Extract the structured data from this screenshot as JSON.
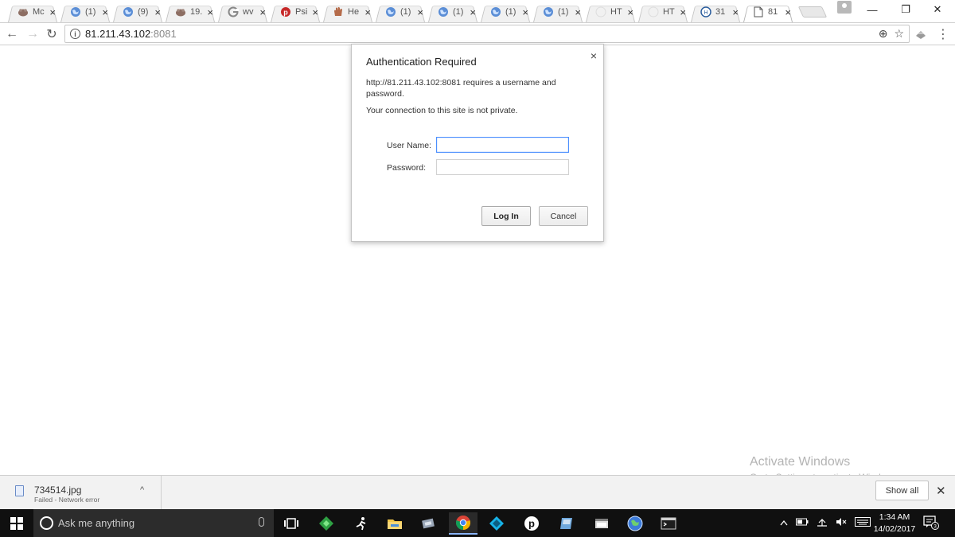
{
  "browser": {
    "tabs": [
      {
        "title": "Mc",
        "icon": "tab-icon-pet",
        "active": false
      },
      {
        "title": "(1)",
        "icon": "tab-icon-globe",
        "active": false
      },
      {
        "title": "(9)",
        "icon": "tab-icon-globe",
        "active": false
      },
      {
        "title": "19.",
        "icon": "tab-icon-pet",
        "active": false
      },
      {
        "title": "wv",
        "icon": "tab-icon-google",
        "active": false
      },
      {
        "title": "Psi",
        "icon": "tab-icon-psiphon",
        "active": false
      },
      {
        "title": "He",
        "icon": "tab-icon-hand",
        "active": false
      },
      {
        "title": "(1)",
        "icon": "tab-icon-globe",
        "active": false
      },
      {
        "title": "(1)",
        "icon": "tab-icon-globe",
        "active": false
      },
      {
        "title": "(1)",
        "icon": "tab-icon-globe",
        "active": false
      },
      {
        "title": "(1)",
        "icon": "tab-icon-globe",
        "active": false
      },
      {
        "title": "HT",
        "icon": "tab-icon-blank",
        "active": false
      },
      {
        "title": "HT",
        "icon": "tab-icon-blank",
        "active": false
      },
      {
        "title": "31",
        "icon": "tab-icon-circle",
        "active": false
      },
      {
        "title": "81",
        "icon": "tab-icon-page",
        "active": true
      }
    ],
    "close_glyph": "×",
    "window": {
      "minimize": "—",
      "restore": "❐",
      "close": "✕"
    },
    "toolbar": {
      "back": "←",
      "forward": "→",
      "reload": "↻",
      "url_host": "81.211.43.102",
      "url_port": ":8081",
      "zoom_glyph": "⊕",
      "star_glyph": "☆",
      "menu_glyph": "⋮"
    }
  },
  "dialog": {
    "title": "Authentication Required",
    "close": "×",
    "message": "http://81.211.43.102:8081 requires a username and password.",
    "privacy": "Your connection to this site is not private.",
    "username_label": "User Name:",
    "password_label": "Password:",
    "username_value": "",
    "password_value": "",
    "login_label": "Log In",
    "cancel_label": "Cancel"
  },
  "watermark": {
    "line1": "Activate Windows",
    "line2": "Go to Settings to activate Windows."
  },
  "download": {
    "filename": "734514.jpg",
    "status": "Failed - Network error",
    "chevron": "^",
    "show_all": "Show all",
    "close": "✕"
  },
  "taskbar": {
    "search_placeholder": "Ask me anything",
    "time": "1:34 AM",
    "date": "14/02/2017",
    "notifications_count": "3",
    "apps": [
      "task-view-icon",
      "green-diamond-app-icon",
      "runner-app-icon",
      "file-explorer-icon",
      "network-app-icon",
      "chrome-icon",
      "kodi-icon",
      "psiphon-icon",
      "blue-app-icon",
      "window-app-icon",
      "globe-app-icon",
      "terminal-app-icon"
    ]
  },
  "colors": {
    "focus_blue": "#4d90fe",
    "taskbar_bg": "#101010",
    "search_bg": "#2c2c2c",
    "watermark": "#b4b4b4"
  }
}
